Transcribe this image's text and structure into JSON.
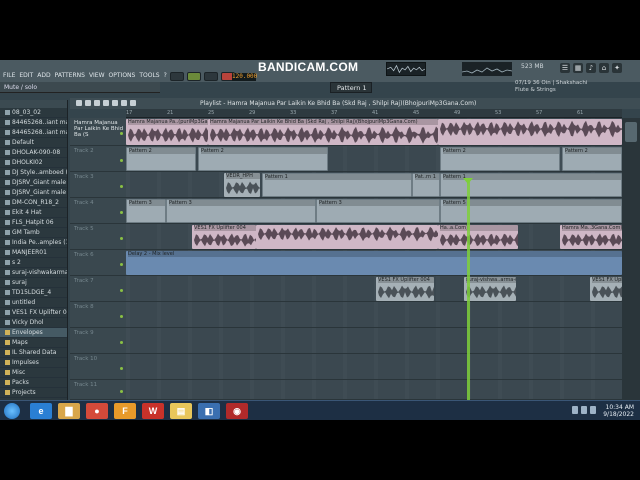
{
  "window": {
    "menu": [
      "FILE",
      "EDIT",
      "ADD",
      "PATTERNS",
      "VIEW",
      "OPTIONS",
      "TOOLS",
      "?"
    ],
    "hint": "Mute / solo",
    "tempo": "120.000",
    "time": "5:14:29",
    "pattern": "Pattern 1",
    "watermark": "BANDICAM.COM",
    "memory": "523 MB",
    "info_line1": "07/19 36 Oin | Shakshachi",
    "info_line2": "Flute & Strings"
  },
  "browser": {
    "header": "Snap 1",
    "items": [
      {
        "label": "08_03_02",
        "folder": false
      },
      {
        "label": "84465268..iant male",
        "folder": false
      },
      {
        "label": "84465268..iant male",
        "folder": false
      },
      {
        "label": "Default",
        "folder": false
      },
      {
        "label": "DHOLAK-090-08",
        "folder": false
      },
      {
        "label": "DHOLKI02",
        "folder": false
      },
      {
        "label": "DJ Style..amboed (4)",
        "folder": false
      },
      {
        "label": "DJSRV_Giant male",
        "folder": false
      },
      {
        "label": "DJSRV_Giant male",
        "folder": false
      },
      {
        "label": "DM-CON_R18_2",
        "folder": false
      },
      {
        "label": "Ekit 4 Hat",
        "folder": false
      },
      {
        "label": "FLS_Hatpit 06",
        "folder": false
      },
      {
        "label": "GM Tamb",
        "folder": false
      },
      {
        "label": "India Pe..amples (17)",
        "folder": false
      },
      {
        "label": "MANJEER01",
        "folder": false
      },
      {
        "label": "s 2",
        "folder": false
      },
      {
        "label": "suraj-vishwakarma-dj",
        "folder": false
      },
      {
        "label": "suraj",
        "folder": false
      },
      {
        "label": "TD15LDGE_4",
        "folder": false
      },
      {
        "label": "untitled",
        "folder": false
      },
      {
        "label": "VES1 FX Uplifter 004",
        "folder": false
      },
      {
        "label": "Vicky Dhol",
        "folder": false
      },
      {
        "label": "Envelopes",
        "folder": true
      },
      {
        "label": "Maps",
        "folder": true
      },
      {
        "label": "IL Shared Data",
        "folder": true
      },
      {
        "label": "Impulses",
        "folder": true
      },
      {
        "label": "Misc",
        "folder": true
      },
      {
        "label": "Packs",
        "folder": true
      },
      {
        "label": "Projects",
        "folder": true
      }
    ]
  },
  "playlist": {
    "title": "Playlist - Hamra Majanua Par Laikin Ke Bhid Ba (Skd Raj , Shilpi Raj)(BhojpuriMp3Gana.Com)",
    "ruler": [
      "17",
      "21",
      "25",
      "29",
      "33",
      "37",
      "41",
      "45",
      "49",
      "53",
      "57",
      "61"
    ],
    "tracks": [
      {
        "label": "Hamra Majanua Par Laikin Ke Bhid Ba (S"
      },
      {
        "label": "Track 2"
      },
      {
        "label": "Track 3"
      },
      {
        "label": "Track 4"
      },
      {
        "label": "Track 5"
      },
      {
        "label": "Track 6"
      },
      {
        "label": "Track 7"
      },
      {
        "label": "Track 8"
      },
      {
        "label": "Track 9"
      },
      {
        "label": "Track 10"
      },
      {
        "label": "Track 11"
      }
    ],
    "clips": {
      "song": "Hamra Majanua Pa..(puriMp3Gana.Com)",
      "song2": "Hamra Majanua Par Laikin Ke Bhid Ba (Skd Raj , Shilpi Raj)(BhojpuriMp3Gana.Com)",
      "pattern2": "Pattern 2",
      "pattern1": "Pattern 1",
      "pattern3": "Pattern 3",
      "pattern5": "Pattern 5",
      "vedr": "VEDR_HPH",
      "pattern_nn": "Pat..rn 1",
      "uplifter": "VES1 FX Uplifter 004",
      "uplifter2": "VES1 FX Uplifter 004",
      "uplifter3": "VES1 FX Upl...004",
      "suraj": "suraj-vishwa..arma-dj",
      "hamra_end": "Hamra Ma..3Gana.Com)",
      "hamra_short": "Ha..a.Com)",
      "ha_short": "Ha..a.Com)",
      "delay": "Delay 2 - Mix level"
    }
  },
  "taskbar": {
    "time": "10:34 AM",
    "date": "9/18/2022",
    "apps": [
      {
        "name": "ie",
        "glyph": "e",
        "color": "#2a7fd4"
      },
      {
        "name": "folder",
        "glyph": "▇",
        "color": "#d8a64a"
      },
      {
        "name": "chrome",
        "glyph": "●",
        "color": "#d44a3a"
      },
      {
        "name": "fl",
        "glyph": "F",
        "color": "#e89a2a"
      },
      {
        "name": "wps",
        "glyph": "W",
        "color": "#c8322a"
      },
      {
        "name": "explorer",
        "glyph": "▤",
        "color": "#e8c65a"
      },
      {
        "name": "media",
        "glyph": "◧",
        "color": "#3a6fb0"
      },
      {
        "name": "bandicam",
        "glyph": "◉",
        "color": "#b02a2a"
      }
    ]
  }
}
